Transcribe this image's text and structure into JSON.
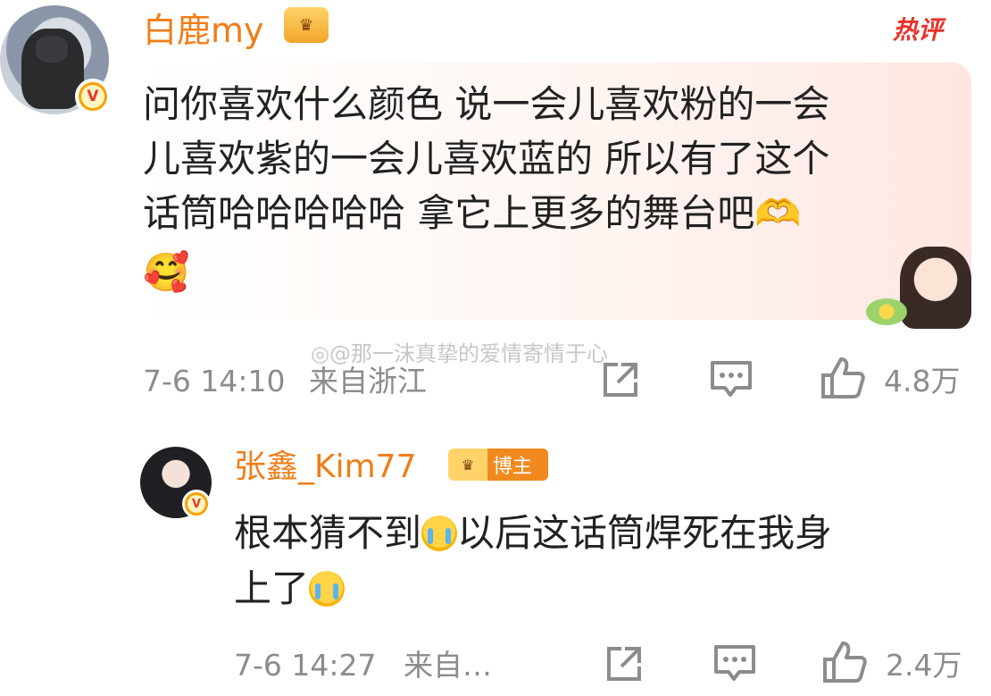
{
  "comments": [
    {
      "username": "白鹿my",
      "hot_label": "热评",
      "content_lines": [
        "问你喜欢什么颜色 说一会儿喜欢粉的一会",
        "儿喜欢紫的一会儿喜欢蓝的 所以有了这个",
        "话筒哈哈哈哈哈 拿它上更多的舞台吧🫶"
      ],
      "emoji_line": "🥰",
      "time": "7-6 14:10",
      "location": "来自浙江",
      "likes": "4.8万"
    },
    {
      "username": "张鑫_Kim77",
      "badge_label": "博主",
      "content_line1_a": "根本猜不到",
      "content_line1_b": "以后这话筒焊死在我身",
      "content_line2": "上了",
      "time": "7-6 14:27",
      "location": "来自…",
      "likes": "2.4万"
    }
  ],
  "watermark": "@那一沫真挚的爱情寄情于心",
  "icons": {
    "verified": "verified-v-icon",
    "share": "share-icon",
    "comment": "comment-icon",
    "like": "thumbs-up-icon",
    "crown": "crown-badge-icon",
    "crying_emoji": "crying-face-emoji"
  },
  "colors": {
    "username": "#f07d18",
    "hot": "#e8332b",
    "meta": "#8c8c8c",
    "text": "#222222"
  }
}
